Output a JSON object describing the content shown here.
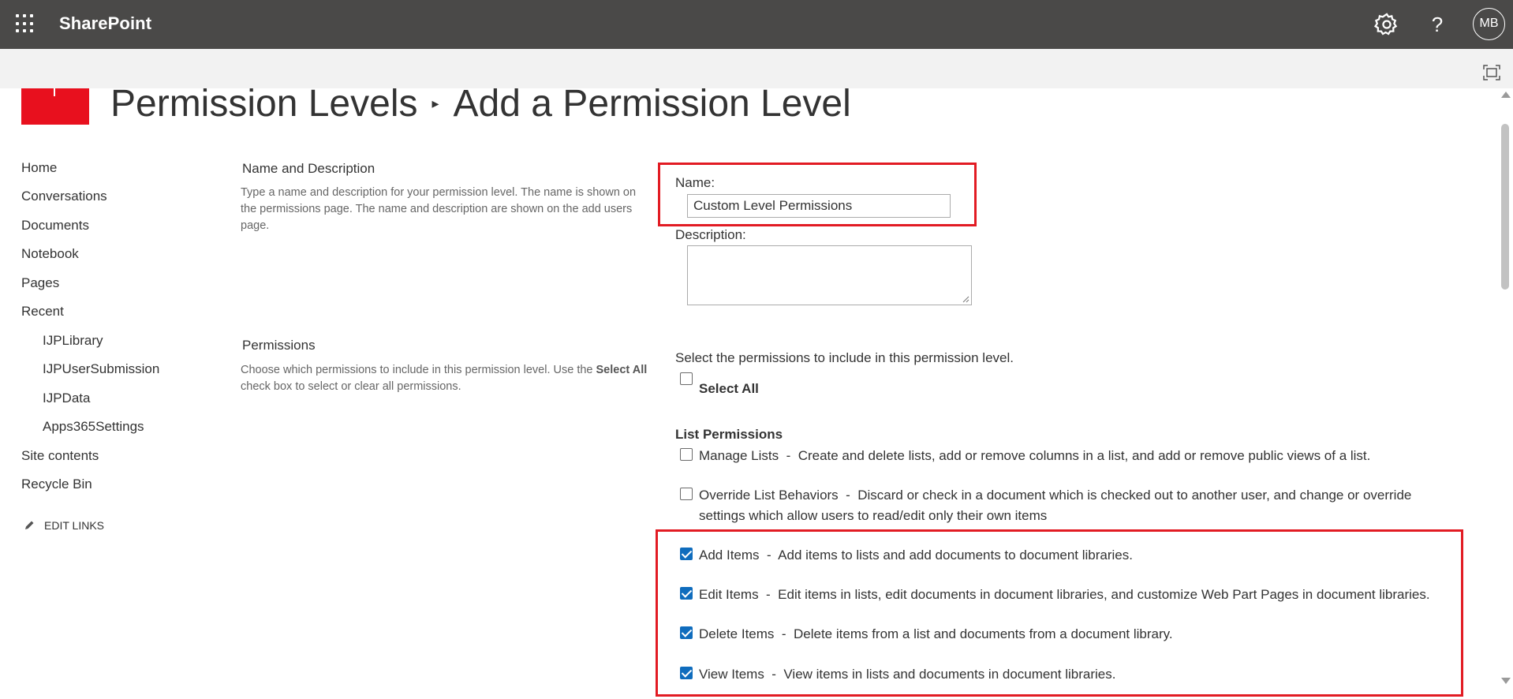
{
  "suite_bar": {
    "app_name": "SharePoint",
    "user_initials": "MB",
    "help_glyph": "?",
    "icons": [
      "app-launcher-icon",
      "gear-icon",
      "help-icon"
    ]
  },
  "page": {
    "breadcrumb_parent": "Permission Levels",
    "title": "Add a Permission Level"
  },
  "left_nav": {
    "items": [
      {
        "label": "Home"
      },
      {
        "label": "Conversations"
      },
      {
        "label": "Documents"
      },
      {
        "label": "Notebook"
      },
      {
        "label": "Pages"
      },
      {
        "label": "Recent"
      },
      {
        "label": "IJPLibrary"
      },
      {
        "label": "IJPUserSubmission"
      },
      {
        "label": "IJPData"
      },
      {
        "label": "Apps365Settings"
      },
      {
        "label": "Site contents"
      },
      {
        "label": "Recycle Bin"
      }
    ],
    "edit_links": "EDIT LINKS"
  },
  "name_section": {
    "heading": "Name and Description",
    "description": "Type a name and description for your permission level.  The name is shown on the permissions page.  The name and description are shown on the add users page.",
    "name_label": "Name:",
    "name_value": "Custom Level Permissions",
    "description_label": "Description:",
    "description_value": ""
  },
  "permissions_section": {
    "heading": "Permissions",
    "description_prefix": "Choose which permissions to include in this permission level.  Use the ",
    "description_bold": "Select All",
    "description_suffix": " check box to select or clear all permissions.",
    "intro": "Select the permissions to include in this permission level.",
    "select_all_label": "Select All",
    "select_all_checked": false,
    "group_heading": "List Permissions",
    "items": [
      {
        "name": "Manage Lists",
        "separator": "  -  ",
        "desc": "Create and delete lists, add or remove columns in a list, and add or remove public views of a list.",
        "checked": false
      },
      {
        "name": "Override List Behaviors",
        "separator": "  -  ",
        "desc": "Discard or check in a document which is checked out to another user, and change or override settings which allow users to read/edit only their own items",
        "checked": false
      },
      {
        "name": "Add Items",
        "separator": "  -  ",
        "desc": "Add items to lists and add documents to document libraries.",
        "checked": true
      },
      {
        "name": "Edit Items",
        "separator": "  -  ",
        "desc": "Edit items in lists, edit documents in document libraries, and customize Web Part Pages in document libraries.",
        "checked": true
      },
      {
        "name": "Delete Items",
        "separator": "  -  ",
        "desc": "Delete items from a list and documents from a document library.",
        "checked": true
      },
      {
        "name": "View Items",
        "separator": "  -  ",
        "desc": "View items in lists and documents in document libraries.",
        "checked": true
      }
    ]
  },
  "colors": {
    "suite_bar": "#4a4948",
    "brand_logo": "#e8101e",
    "highlight_box": "#e21b23",
    "checkbox_checked": "#0f6cbd"
  }
}
